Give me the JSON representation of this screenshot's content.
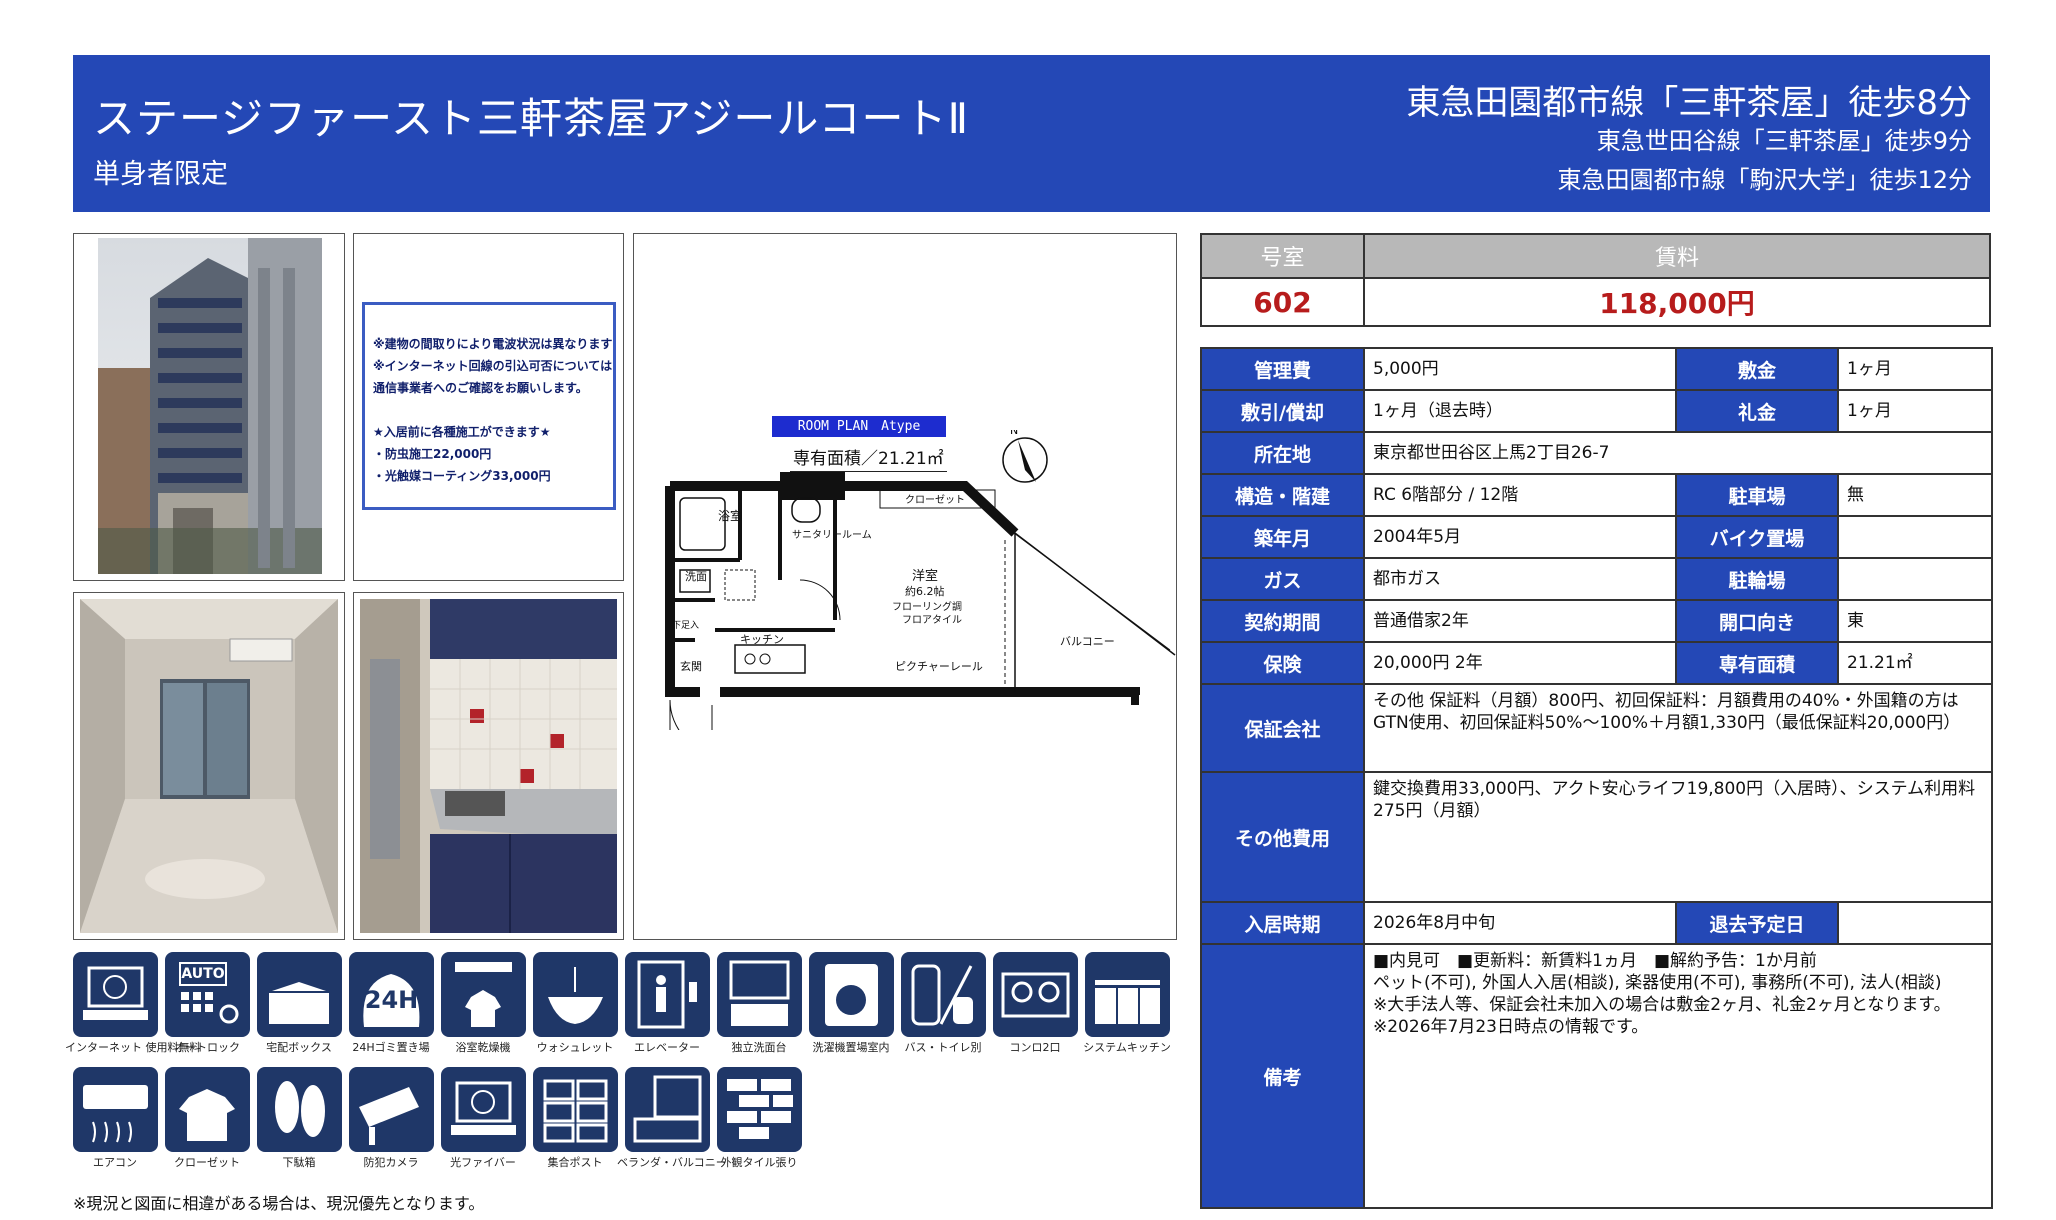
{
  "header": {
    "title": "ステージファースト三軒茶屋アジールコートⅡ",
    "subtitle": "単身者限定",
    "stations": [
      "東急田園都市線「三軒茶屋」徒歩8分",
      "東急世田谷線「三軒茶屋」徒歩9分",
      "東急田園都市線「駒沢大学」徒歩12分"
    ]
  },
  "notice": {
    "lines": [
      "※建物の間取りにより電波状況は異なります",
      "※インターネット回線の引込可否については",
      "通信事業者へのご確認をお願いします。",
      "",
      "★入居前に各種施工ができます★",
      "・防虫施工22,000円",
      "・光触媒コーティング33,000円"
    ]
  },
  "floorplan": {
    "badge": "ROOM PLAN　Atype",
    "area": "専有面積／21.21㎡",
    "labels": {
      "bath": "浴室",
      "sanitary": "サニタリールーム",
      "closet": "クローゼット",
      "room": "洋室",
      "room_size": "約6.2帖",
      "floor": "フローリング調",
      "floor2": "フロアタイル",
      "wash": "洗面",
      "kitchen": "キッチン",
      "shoes": "下足入",
      "entrance": "玄関",
      "picture_rail": "ピクチャーレール",
      "balcony": "バルコニー",
      "north": "N"
    }
  },
  "amenities": [
    {
      "label": "インターネット\n使用料無料",
      "icon": "computer-icon"
    },
    {
      "label": "オートロック",
      "icon": "auto-lock-icon",
      "text": "AUTO"
    },
    {
      "label": "宅配ボックス",
      "icon": "delivery-box-icon"
    },
    {
      "label": "24Hゴミ置き場",
      "icon": "garbage-24h-icon",
      "text": "24H"
    },
    {
      "label": "浴室乾燥機",
      "icon": "bath-dryer-icon"
    },
    {
      "label": "ウォシュレット",
      "icon": "washlet-icon"
    },
    {
      "label": "エレベーター",
      "icon": "elevator-icon"
    },
    {
      "label": "独立洗面台",
      "icon": "vanity-icon"
    },
    {
      "label": "洗濯機置場室内",
      "icon": "washing-machine-icon"
    },
    {
      "label": "バス・トイレ別",
      "icon": "bath-toilet-icon"
    },
    {
      "label": "コンロ2口",
      "icon": "stove-icon"
    },
    {
      "label": "システムキッチン",
      "icon": "kitchen-icon"
    },
    {
      "label": "エアコン",
      "icon": "air-conditioner-icon"
    },
    {
      "label": "クローゼット",
      "icon": "closet-icon"
    },
    {
      "label": "下駄箱",
      "icon": "shoe-box-icon"
    },
    {
      "label": "防犯カメラ",
      "icon": "security-camera-icon"
    },
    {
      "label": "光ファイバー",
      "icon": "fiber-icon"
    },
    {
      "label": "集合ポスト",
      "icon": "mailbox-icon"
    },
    {
      "label": "ベランダ・バルコニー",
      "icon": "balcony-icon"
    },
    {
      "label": "外観タイル張り",
      "icon": "tile-icon"
    }
  ],
  "disclaimer": "※現況と図面に相違がある場合は、現況優先となります。",
  "summary": {
    "room_label": "号室",
    "rent_label": "賃料",
    "room": "602",
    "rent": "118,000円"
  },
  "details": {
    "kanri_k": "管理費",
    "kanri_v": "5,000円",
    "shiki_k": "敷金",
    "shiki_v": "1ヶ月",
    "shikibiki_k": "敷引/償却",
    "shikibiki_v": "1ヶ月（退去時）",
    "rei_k": "礼金",
    "rei_v": "1ヶ月",
    "addr_k": "所在地",
    "addr_v": "東京都世田谷区上馬2丁目26-7",
    "struct_k": "構造・階建",
    "struct_v": "RC 6階部分 / 12階",
    "parking_k": "駐車場",
    "parking_v": "無",
    "built_k": "築年月",
    "built_v": "2004年5月",
    "bike_k": "バイク置場",
    "bike_v": "",
    "gas_k": "ガス",
    "gas_v": "都市ガス",
    "bicycle_k": "駐輪場",
    "bicycle_v": "",
    "contract_k": "契約期間",
    "contract_v": "普通借家2年",
    "facing_k": "開口向き",
    "facing_v": "東",
    "insurance_k": "保険",
    "insurance_v": "20,000円 2年",
    "area_k": "専有面積",
    "area_v": "21.21㎡",
    "guarantor_k": "保証会社",
    "guarantor_v": "その他 保証料（月額）800円、初回保証料：月額費用の40%・外国籍の方は\nGTN使用、初回保証料50%～100%＋月額1,330円（最低保証料20,000円）",
    "other_k": "その他費用",
    "other_v": "鍵交換費用33,000円、アクト安心ライフ19,800円（入居時）、システム利用料\n275円（月額）",
    "movein_k": "入居時期",
    "movein_v": "2026年8月中旬",
    "moveout_k": "退去予定日",
    "moveout_v": "",
    "remarks_k": "備考",
    "remarks_v": "■内見可　■更新料：新賃料1ヵ月　■解約予告：1か月前\nペット(不可), 外国人入居(相談), 楽器使用(不可), 事務所(不可), 法人(相談)\n※大手法人等、保証会社未加入の場合は敷金2ヶ月、礼金2ヶ月となります。\n※2026年7月23日時点の情報です。"
  }
}
